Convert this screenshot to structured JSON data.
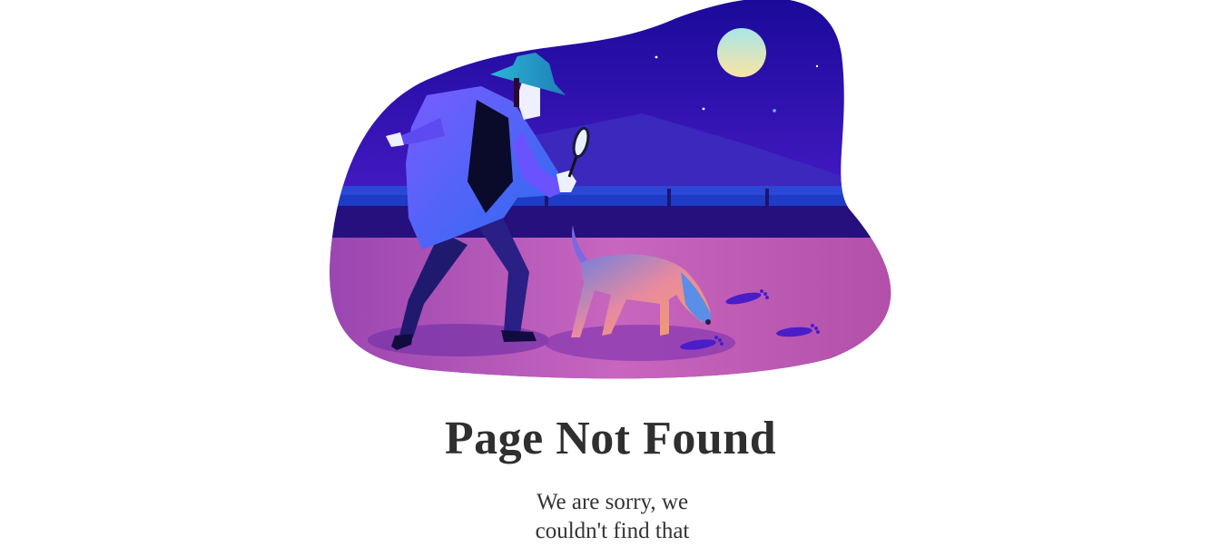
{
  "error_page": {
    "title": "Page Not Found",
    "message": "We are sorry, we couldn't find that"
  },
  "illustration": {
    "subject": "detective-with-dog-following-footprints",
    "colors": {
      "sky_dark": "#23089b",
      "sky_light": "#6d2ed8",
      "moon": "#f5e3a0",
      "ground": "#c05cb8",
      "coat": "#5b4df2",
      "hat": "#2aa7c9"
    }
  },
  "colors": {
    "background": "#ffffff",
    "heading_text": "#2f2f2f",
    "body_text": "#333333"
  }
}
